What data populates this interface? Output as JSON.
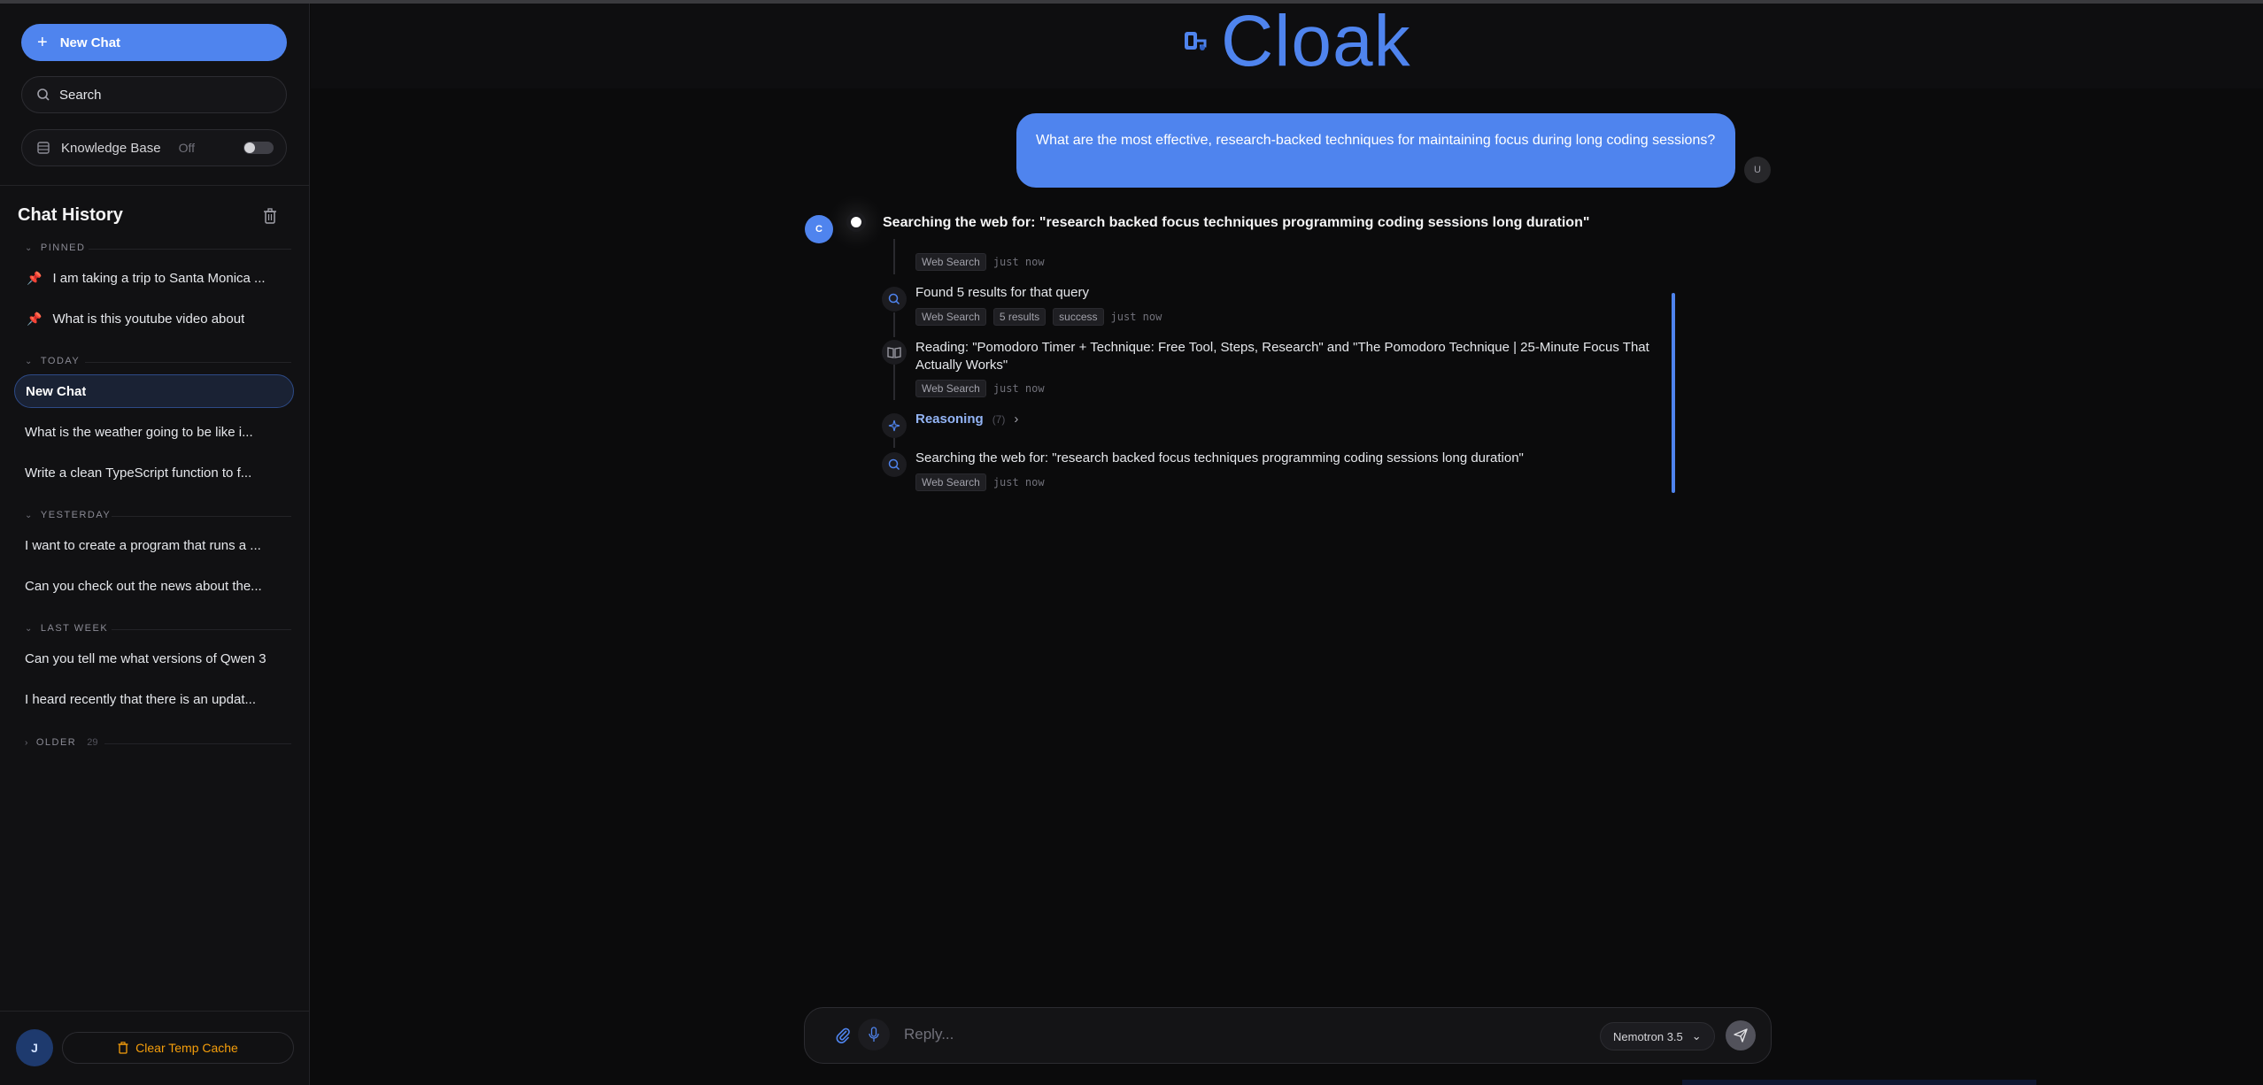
{
  "sidebar": {
    "new_chat_label": "New Chat",
    "search_placeholder": "Search",
    "knowledge_base": {
      "label": "Knowledge Base",
      "state": "Off"
    },
    "history_title": "Chat History",
    "groups": {
      "pinned": "PINNED",
      "today": "TODAY",
      "yesterday": "YESTERDAY",
      "last_week": "LAST WEEK",
      "older": "OLDER",
      "older_count": "29"
    },
    "pinned_items": [
      "I am taking a trip to Santa Monica ...",
      "What is this youtube video about"
    ],
    "today_items": [
      "New Chat",
      "What is the weather going to be like i...",
      "Write a clean TypeScript function to f..."
    ],
    "yesterday_items": [
      "I want to create a program that runs a ...",
      "Can you check out the news about the..."
    ],
    "last_week_items": [
      "Can you tell me what versions of Qwen 3",
      "I heard recently that there is an updat..."
    ],
    "user_initial": "J",
    "clear_cache_label": "Clear Temp Cache"
  },
  "header": {
    "logo_text": "Cloak"
  },
  "conversation": {
    "user_initial": "U",
    "user_message": "What are the most effective, research-backed techniques for maintaining focus during long coding sessions?",
    "assistant_initial": "C",
    "status": "Searching the web for: \"research backed focus techniques programming coding sessions long duration\"",
    "steps": [
      {
        "text": "",
        "tags": [
          "Web Search"
        ],
        "time": "just now",
        "icon": "search-icon"
      },
      {
        "text": "Found 5 results for that query",
        "tags": [
          "Web Search",
          "5 results",
          "success"
        ],
        "time": "just now",
        "icon": "search-icon"
      },
      {
        "text": "Reading: \"Pomodoro Timer + Technique: Free Tool, Steps, Research\" and \"The Pomodoro Technique | 25-Minute Focus That Actually Works\"",
        "tags": [
          "Web Search"
        ],
        "time": "just now",
        "icon": "book-icon"
      },
      {
        "text": "Searching the web for: \"research backed focus techniques programming coding sessions long duration\"",
        "tags": [
          "Web Search"
        ],
        "time": "just now",
        "icon": "search-icon"
      }
    ],
    "reasoning": {
      "label": "Reasoning",
      "count": "(7)"
    }
  },
  "composer": {
    "placeholder": "Reply...",
    "model": "Nemotron 3.5"
  },
  "colors": {
    "accent": "#4f84ee",
    "background": "#0b0b0c",
    "sidebar": "#111113",
    "warning": "#f59e0b"
  }
}
